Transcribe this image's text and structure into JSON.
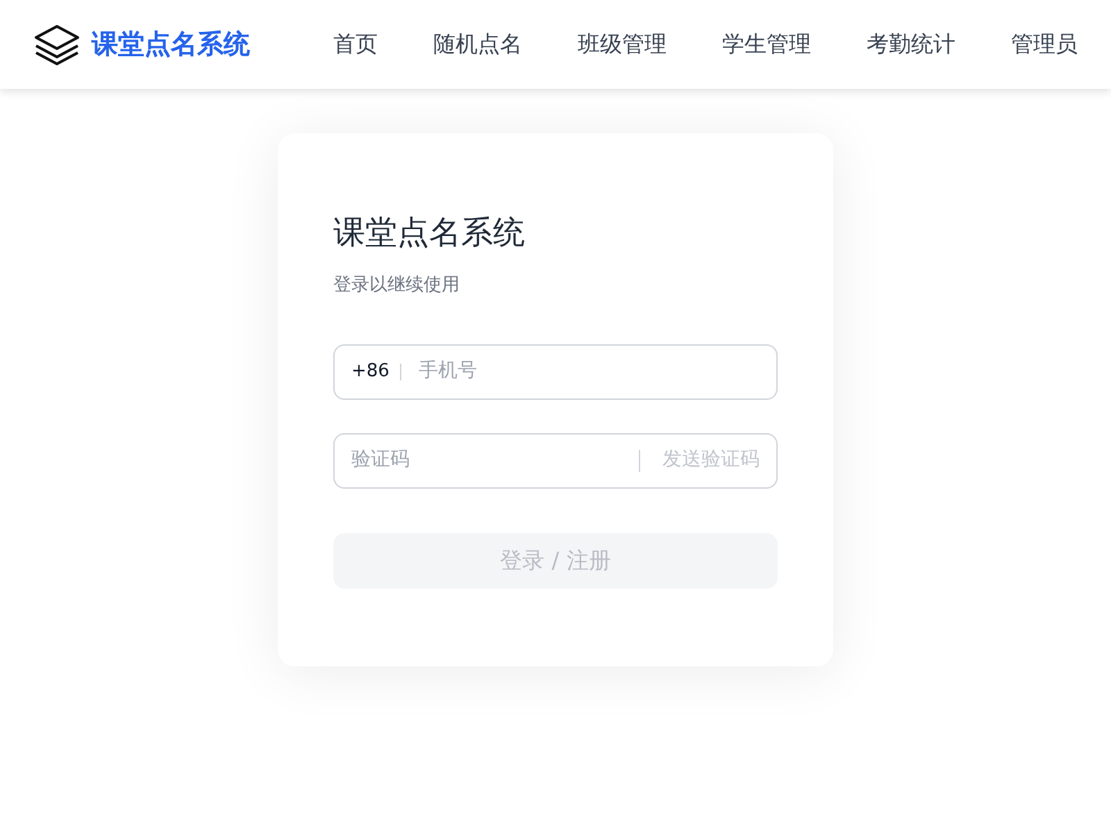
{
  "header": {
    "brand": "课堂点名系统",
    "nav": [
      "首页",
      "随机点名",
      "班级管理",
      "学生管理",
      "考勤统计",
      "管理员"
    ]
  },
  "login": {
    "title": "课堂点名系统",
    "subtitle": "登录以继续使用",
    "phone": {
      "prefix": "+86",
      "placeholder": "手机号"
    },
    "code": {
      "placeholder": "验证码",
      "send_label": "发送验证码",
      "send_disabled": true
    },
    "submit": {
      "label": "登录 / 注册",
      "disabled": true
    }
  }
}
